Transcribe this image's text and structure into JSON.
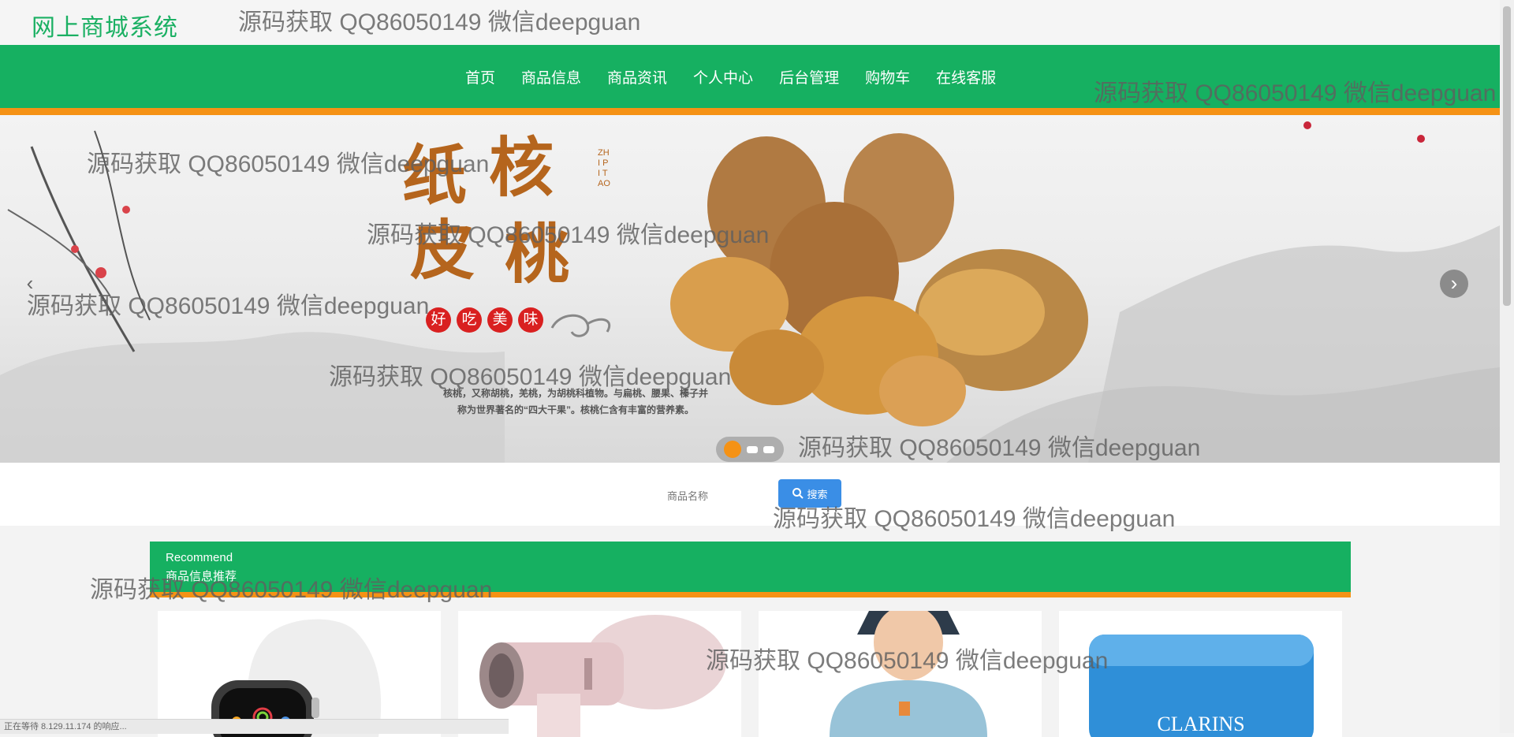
{
  "site": {
    "title": "网上商城系统"
  },
  "nav": {
    "items": [
      "首页",
      "商品信息",
      "商品资讯",
      "个人中心",
      "后台管理",
      "购物车",
      "在线客服"
    ]
  },
  "banner": {
    "big_chars": [
      "纸",
      "核",
      "皮",
      "桃"
    ],
    "vertical_text": "ZHI PI TAO",
    "taste_badges": [
      "好",
      "吃",
      "美",
      "味"
    ],
    "description_line1": "核桃，又称胡桃，羌桃，为胡桃科植物。与扁桃、腰果、榛子并",
    "description_line2": "称为世界著名的“四大干果”。核桃仁含有丰富的营养素。",
    "prev_icon": "chevron-left-icon",
    "next_icon": "chevron-right-icon",
    "slides_count": 3,
    "active_slide": 1
  },
  "search": {
    "placeholder": "商品名称",
    "button_label": "搜索"
  },
  "recommend": {
    "title_en": "Recommend",
    "title_cn": "商品信息推荐"
  },
  "products": [
    {
      "image": "smartwatch-image"
    },
    {
      "image": "hair-dryer-image"
    },
    {
      "image": "hoodie-model-image"
    },
    {
      "image": "cream-jar-image",
      "brand_text": "CLARINS"
    }
  ],
  "watermark": "源码获取 QQ86050149 微信deepguan",
  "status_bar": "正在等待 8.129.11.174 的响应...",
  "colors": {
    "primary_green": "#16b061",
    "accent_orange": "#f59215",
    "search_blue": "#3a8ee6"
  }
}
